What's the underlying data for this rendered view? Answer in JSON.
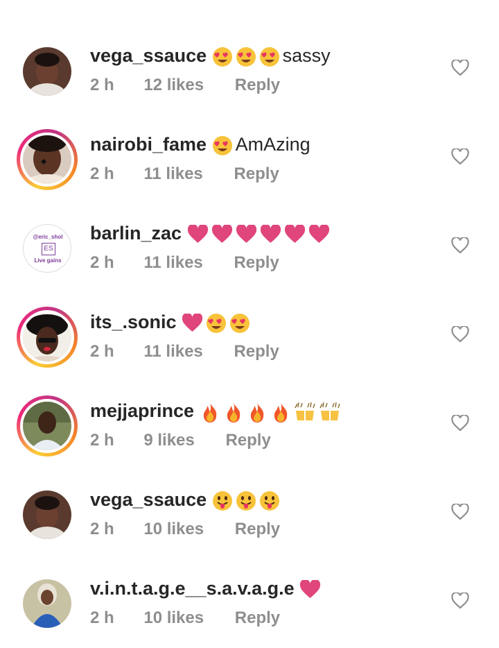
{
  "comments": [
    {
      "username": "vega_ssauce",
      "emojis": [
        "heart-eyes",
        "heart-eyes",
        "heart-eyes"
      ],
      "text": "sassy",
      "time": "2 h",
      "likes": "12 likes",
      "reply": "Reply",
      "story_ring": false
    },
    {
      "username": "nairobi_fame",
      "emojis": [
        "heart-eyes"
      ],
      "text": "AmAzing",
      "time": "2 h",
      "likes": "11 likes",
      "reply": "Reply",
      "story_ring": true
    },
    {
      "username": "barlin_zac",
      "emojis": [
        "pink-heart",
        "pink-heart",
        "pink-heart",
        "pink-heart",
        "pink-heart",
        "pink-heart"
      ],
      "text": "",
      "time": "2 h",
      "likes": "11 likes",
      "reply": "Reply",
      "story_ring": false,
      "avatar_text": {
        "handle": "@eric_shol",
        "monogram": "ES",
        "tagline": "Live gains"
      }
    },
    {
      "username": "its_.sonic",
      "emojis": [
        "pink-heart",
        "heart-eyes",
        "heart-eyes"
      ],
      "text": "",
      "time": "2 h",
      "likes": "11 likes",
      "reply": "Reply",
      "story_ring": true
    },
    {
      "username": "mejjaprince",
      "emojis": [
        "fire",
        "fire",
        "fire",
        "fire",
        "raising-hands",
        "raising-hands"
      ],
      "text": "",
      "time": "2 h",
      "likes": "9 likes",
      "reply": "Reply",
      "story_ring": true
    },
    {
      "username": "vega_ssauce",
      "emojis": [
        "tongue-face",
        "tongue-face",
        "tongue-face"
      ],
      "text": "",
      "time": "2 h",
      "likes": "10 likes",
      "reply": "Reply",
      "story_ring": false
    },
    {
      "username": "v.i.n.t.a.g.e__s.a.v.a.g.e",
      "emojis": [
        "pink-heart"
      ],
      "text": "",
      "time": "2 h",
      "likes": "10 likes",
      "reply": "Reply",
      "story_ring": false
    }
  ],
  "colors": {
    "username": "#262626",
    "meta": "#8e8e8e",
    "heart_emoji": "#e0457b",
    "like_icon": "#8e8e8e"
  },
  "icons": {
    "like_button": "heart-outline-icon"
  }
}
